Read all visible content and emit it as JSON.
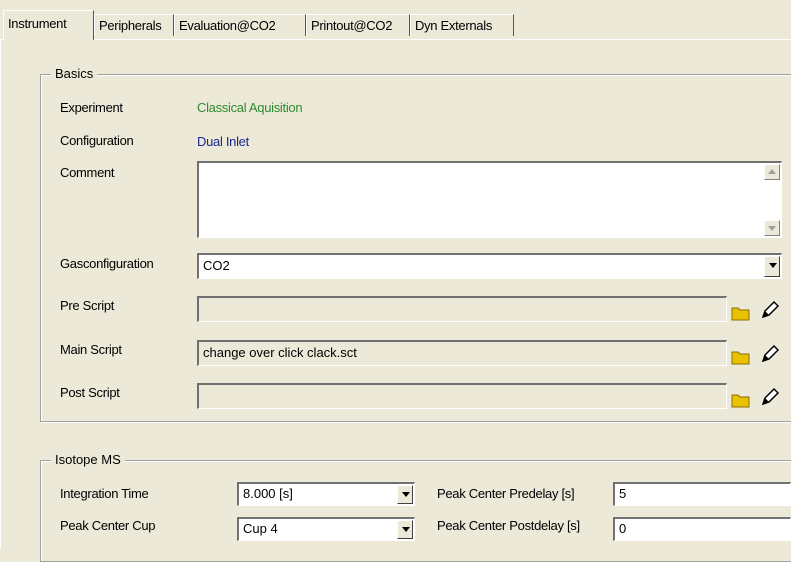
{
  "tabs": [
    "Instrument",
    "Peripherals",
    "Evaluation@CO2",
    "Printout@CO2",
    "Dyn Externals"
  ],
  "basics": {
    "group_label": "Basics",
    "experiment_label": "Experiment",
    "experiment_value": "Classical Aquisition",
    "configuration_label": "Configuration",
    "configuration_value": "Dual Inlet",
    "comment_label": "Comment",
    "comment_value": "",
    "gasconfiguration_label": "Gasconfiguration",
    "gasconfiguration_value": "CO2",
    "pre_script_label": "Pre Script",
    "pre_script_value": "",
    "main_script_label": "Main Script",
    "main_script_value": "change over click clack.sct",
    "post_script_label": "Post Script",
    "post_script_value": ""
  },
  "isotope_ms": {
    "group_label": "Isotope MS",
    "integration_time_label": "Integration Time",
    "integration_time_value": "8.000 [s]",
    "peak_center_cup_label": "Peak Center Cup",
    "peak_center_cup_value": "Cup 4",
    "peak_center_predelay_label": "Peak Center Predelay [s]",
    "peak_center_predelay_value": "5",
    "peak_center_postdelay_label": "Peak Center Postdelay [s]",
    "peak_center_postdelay_value": "0"
  },
  "colors": {
    "experiment": "#2e8b2e",
    "configuration": "#1a2a8a",
    "folder_icon": "#e8c200"
  },
  "icons": [
    "folder-icon",
    "edit-pencil-icon",
    "scroll-up-arrow-icon",
    "scroll-down-arrow-icon",
    "dropdown-arrow-icon"
  ]
}
